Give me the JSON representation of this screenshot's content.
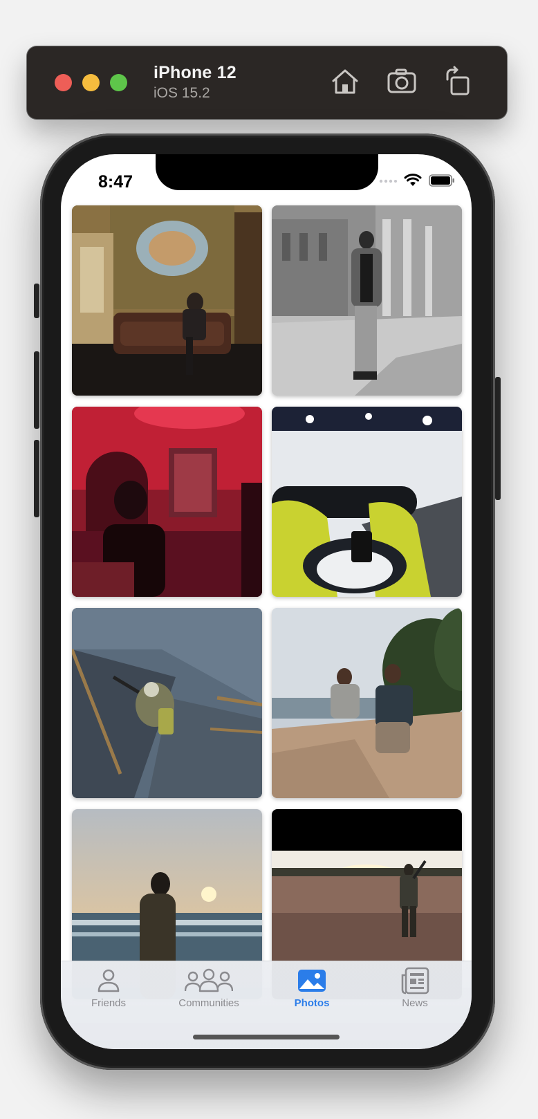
{
  "simulator": {
    "device_name": "iPhone 12",
    "os_version": "iOS 15.2",
    "buttons": [
      "home-icon",
      "screenshot-icon",
      "rotate-icon"
    ]
  },
  "status_bar": {
    "time": "8:47",
    "icons": [
      "cellular-signal-icon",
      "wifi-icon",
      "battery-icon"
    ]
  },
  "photos": [
    {
      "scene": "man seated on leather sofa in ornate room"
    },
    {
      "scene": "black and white man standing before palace"
    },
    {
      "scene": "man in red-lit room"
    },
    {
      "scene": "snowboard on snowy slope at night"
    },
    {
      "scene": "aerial view of soldier on stairs"
    },
    {
      "scene": "two men sitting on coastal rocks"
    },
    {
      "scene": "man silhouette at seaside sunset"
    },
    {
      "scene": "soldier in field at sunset"
    }
  ],
  "tabbar": {
    "items": [
      {
        "label": "Friends",
        "icon": "person-icon",
        "active": false
      },
      {
        "label": "Communities",
        "icon": "group-icon",
        "active": false
      },
      {
        "label": "Photos",
        "icon": "photo-icon",
        "active": true
      },
      {
        "label": "News",
        "icon": "newspaper-icon",
        "active": false
      }
    ],
    "active_color": "#2b7de9",
    "inactive_color": "#8a8a8e"
  }
}
